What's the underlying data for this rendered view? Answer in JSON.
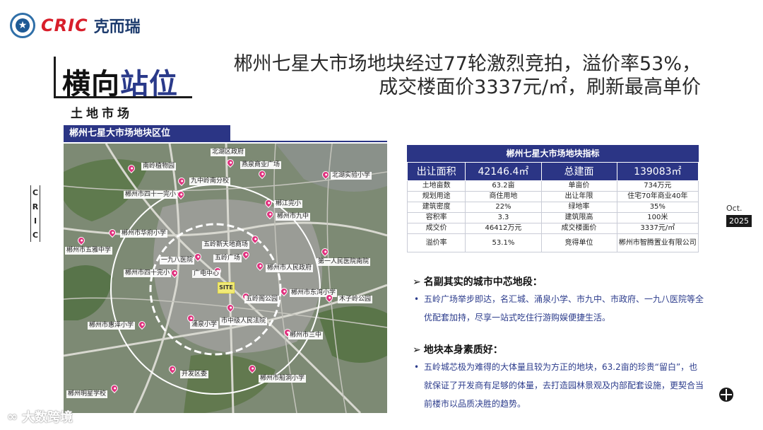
{
  "header": {
    "logo_cric": "CRIC",
    "logo_cn": "克而瑞",
    "emblem_glyph": "★"
  },
  "section": {
    "title_a": "横向",
    "title_b": "站位",
    "subtitle": "土地市场"
  },
  "headline": {
    "line1": "郴州七星大市场地块经过77轮激烈竞拍，溢价率53%，",
    "line2": "成交楼面价3337元/㎡，刷新最高单价"
  },
  "side_tag": [
    "C",
    "R",
    "I",
    "C"
  ],
  "date": {
    "month": "Oct.",
    "year": "2025"
  },
  "map": {
    "title": "郴州七星大市场地块区位",
    "site_label": "SITE",
    "labels": [
      "南岭植物园",
      "北湖区政府",
      "燕泉商业广场",
      "北湖实验小学",
      "九中岭南分校",
      "郴州市四十一完小",
      "郴江完小",
      "郴州市九中",
      "郴州市华府小学",
      "五岭新天地商场",
      "郴州市五雅中学",
      "一九八医院",
      "五岭广场",
      "第一人民医院南院",
      "郴州市人民政府",
      "郴州市四十完小",
      "广电中心",
      "郴州市东湾小学",
      "木子岭公园",
      "五岭阁公园",
      "涌泉小学",
      "市中级人民法院",
      "郴州市惠泽小学",
      "郴州市三中",
      "开发区委",
      "郴州市船洞小学",
      "郴州明星学校"
    ]
  },
  "table": {
    "title": "郴州七星大市场地块指标",
    "main_row": [
      "出让面积",
      "42146.4㎡",
      "总建面",
      "139083㎡"
    ],
    "rows": [
      [
        "土地亩数",
        "63.2亩",
        "单亩价",
        "734万元"
      ],
      [
        "规划用途",
        "商住用地",
        "出让年限",
        "住宅70年商业40年"
      ],
      [
        "建筑密度",
        "22%",
        "绿地率",
        "35%"
      ],
      [
        "容积率",
        "3.3",
        "建筑限高",
        "100米"
      ],
      [
        "成交价",
        "46412万元",
        "成交楼面价",
        "3337元/㎡"
      ],
      [
        "溢价率",
        "53.1%",
        "竞得单位",
        "郴州市智腾置业有限公司"
      ]
    ]
  },
  "points": [
    {
      "arrow": "➢",
      "heading": "名副其实的城市中芯地段：",
      "bullet": "•",
      "text": "五岭广场举步即达，名汇城、涌泉小学、市九中、市政府、一九八医院等全优配套加持，尽享一站式吃住行游购娱便捷生活。"
    },
    {
      "arrow": "➢",
      "heading": "地块本身素质好：",
      "bullet": "•",
      "text": "五岭城芯极为难得的大体量且较为方正的地块，63.2亩的珍贵“留白”，也就保证了开发商有足够的体量，去打造园林景观及内部配套设施，更契合当前楼市以品质决胜的趋势。"
    }
  ],
  "watermark": {
    "icon": "∞",
    "text": "大数跨境"
  },
  "colors": {
    "accent": "#2b3585",
    "brand_red": "#d81e2a",
    "pin": "#e0327e"
  }
}
